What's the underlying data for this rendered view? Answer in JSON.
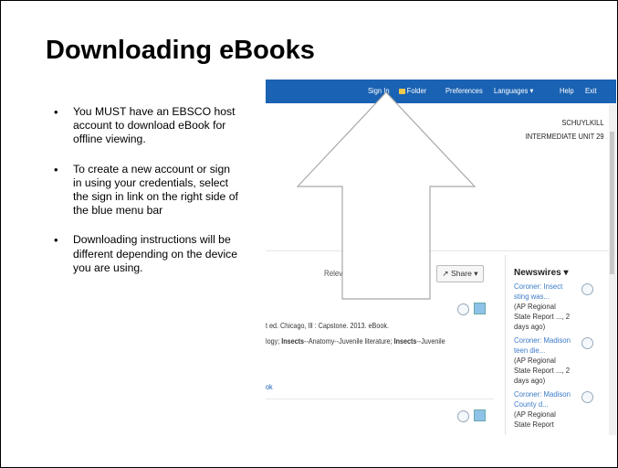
{
  "slide": {
    "title": "Downloading eBooks",
    "bullets": [
      "You MUST have an EBSCO host account to download eBook for  offline viewing.",
      "To create a new account or sign in using your credentials, select the sign in link on the right side of the blue menu bar",
      "Downloading instructions will be different depending on the device you are using."
    ]
  },
  "screenshot": {
    "menu": {
      "sign_in": "Sign In",
      "folder": "Folder",
      "preferences": "Preferences",
      "languages": "Languages ▾",
      "help": "Help",
      "exit": "Exit"
    },
    "institution": [
      "SCHUYLKILL",
      "INTERMEDIATE UNIT 29"
    ],
    "relevance_fragment": "Relev",
    "share_label": "Share ▾",
    "newswires_label": "Newswires ▾",
    "result_lines": {
      "publication": "t ed. Chicago, Ill : Capstone. 2013. eBook.",
      "subjects_prefix": "logy; ",
      "subj1": "Insects",
      "subjects_mid": "--Anatomy--Juvenile literature; ",
      "subj2": "Insects",
      "subjects_suffix": "--Juvenile",
      "link_fragment": "ok"
    },
    "newswires": [
      {
        "title": "Coroner: Insect sting was...",
        "meta": "(AP Regional State Report ..., 2 days ago)"
      },
      {
        "title": "Coroner: Madison teen die...",
        "meta": "(AP Regional State Report ..., 2 days ago)"
      },
      {
        "title": "Coroner: Madison County d...",
        "meta": "(AP Regional State Report"
      }
    ],
    "icons": {
      "arrow": "up-arrow-icon",
      "folder": "folder-icon",
      "share": "share-icon",
      "search": "magnifier-icon",
      "book": "book-icon"
    },
    "colors": {
      "menubar": "#1a62b3",
      "link": "#3b7bc8"
    }
  }
}
